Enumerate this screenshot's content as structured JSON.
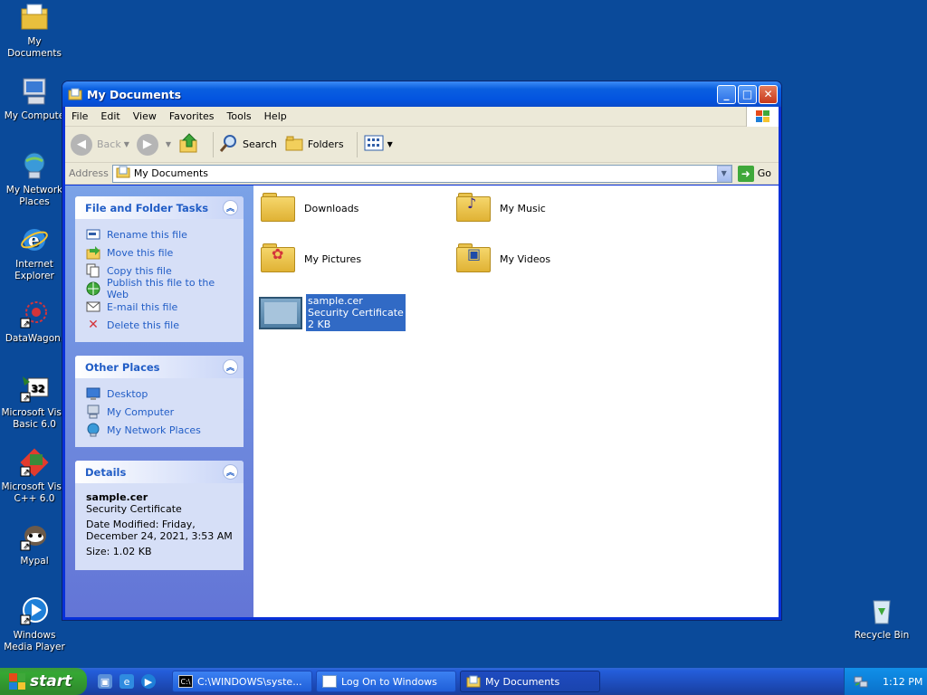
{
  "desktop": {
    "icons": [
      {
        "label": "My Documents"
      },
      {
        "label": "My Compute"
      },
      {
        "label": "My Network Places"
      },
      {
        "label": "Internet Explorer"
      },
      {
        "label": "DataWagon."
      },
      {
        "label": "Microsoft Visu Basic 6.0"
      },
      {
        "label": "Microsoft Visu C++ 6.0"
      },
      {
        "label": "Mypal"
      },
      {
        "label": "Windows Media Player"
      },
      {
        "label": "Recycle Bin"
      }
    ]
  },
  "window": {
    "title": "My Documents",
    "menu": [
      "File",
      "Edit",
      "View",
      "Favorites",
      "Tools",
      "Help"
    ],
    "toolbar": {
      "back": "Back",
      "search": "Search",
      "folders": "Folders"
    },
    "address": {
      "label": "Address",
      "value": "My Documents",
      "go": "Go"
    },
    "sidebar": {
      "file_tasks": {
        "title": "File and Folder Tasks",
        "items": [
          "Rename this file",
          "Move this file",
          "Copy this file",
          "Publish this file to the Web",
          "E-mail this file",
          "Delete this file"
        ]
      },
      "other_places": {
        "title": "Other Places",
        "items": [
          "Desktop",
          "My Computer",
          "My Network Places"
        ]
      },
      "details": {
        "title": "Details",
        "name": "sample.cer",
        "type": "Security Certificate",
        "modified": "Date Modified: Friday, December 24, 2021, 3:53 AM",
        "size": "Size: 1.02 KB"
      }
    },
    "items": [
      {
        "name": "Downloads"
      },
      {
        "name": "My Music"
      },
      {
        "name": "My Pictures"
      },
      {
        "name": "My Videos"
      },
      {
        "name": "sample.cer",
        "type": "Security Certificate",
        "size": "2 KB"
      }
    ]
  },
  "taskbar": {
    "start": "start",
    "buttons": [
      "C:\\WINDOWS\\syste...",
      "Log On to Windows",
      "My Documents"
    ],
    "clock": "1:12 PM"
  }
}
